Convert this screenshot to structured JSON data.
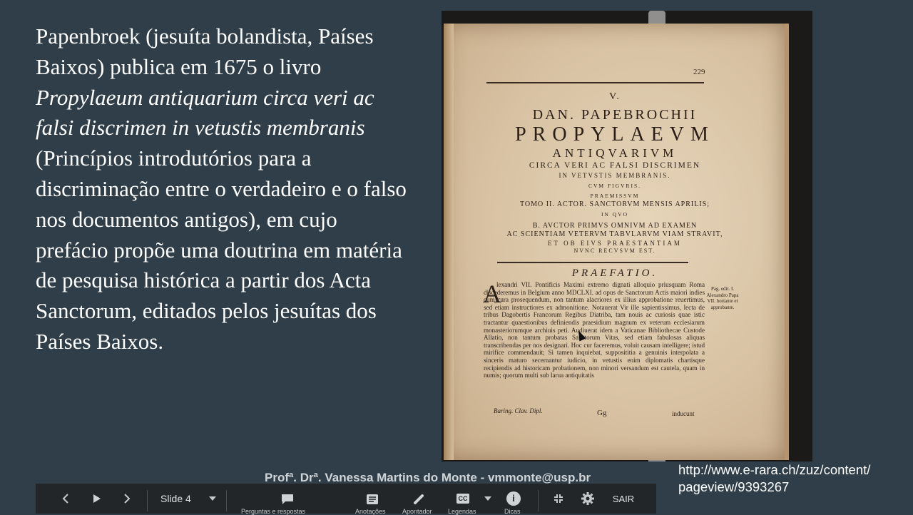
{
  "slide": {
    "text_before": "Papenbroek (jesuíta bolandista, Países Baixos) publica em 1675 o livro ",
    "italic_title": "Propylaeum antiquarium circa veri ac falsi discrimen in vetustis membranis",
    "text_after": " (Princípios introdutórios para a discriminação entre o verdadeiro e o falso nos documentos antigos), em cujo prefácio propõe uma doutrina em matéria de pesquisa histórica a partir dos Acta Sanctorum, editados pelos jesuítas dos Países Baixos."
  },
  "book_page": {
    "page_number": "229",
    "line_v": "V.",
    "line_dan": "DAN. PAPEBROCHII",
    "line_propylaeum": "PROPYLAEVM",
    "line_antiquarium": "ANTIQVARIVM",
    "line_circa": "CIRCA VERI AC FALSI DISCRIMEN",
    "line_in": "IN VETVSTIS MEMBRANIS.",
    "line_cum": "CVM FIGVRIS.",
    "line_praemissum": "PRAEMISSVM",
    "line_tomo": "TOMO II. ACTOR. SANCTORVM MENSIS APRILIS;",
    "line_inquo": "IN QVO",
    "line_bauc": "B. AVCTOR PRIMVS OMNIVM AD EXAMEN",
    "line_ac": "AC SCIENTIAM VETERVM TABVLARVM VIAM STRAVIT,",
    "line_et": "ET OB EIVS PRAESTANTIAM",
    "line_nunc": "NVNC RECVSVM EST.",
    "praefatio": "PRAEFATIO.",
    "dropcap": "A",
    "body": "lexandri VII. Pontificis Maximi extremo dignati alloquio priusquam Roma discederemus in Belgium anno MDCLXI. ad opus de Sanctorum Actis maiori indies cum cura prosequendum, non tantum alacriores ex illius approbatione reuertimus, sed etiam instructiores ex admonitione. Notauerat Vir ille sapientissimus, lecta de tribus Dagobertis Francorum Regibus Diatriba, tam nouis ac curiosis quae istic tractantur quaestionibus definiendis praesidium magnum ex veterum ecclesiarum monasteriorumque archiuis peti. Audiuerat idem a Vaticanae Bibliothecae Custode Allatio, non tantum probatas Sanctorum Vitas, sed etiam fabulosas aliquas transcribendas per nos designari. Hoc cur faceremus, voluit causam intelligere; istud mirifice commendauit; Si tamen inquiebat, supposititia a genuinis interpolata a sinceris maturo secernantur iudicio, in vetustis enim diplomatis chartisque recipiendis ad historicam probationem, non minori versandum est cautela, quam in numis; quorum multi sub larua antiquitatis",
    "margin_note": "Pag. edit. I. Alexandro Papa VII. hortante et approbante.",
    "foot_left": "Baring. Clav. Dipl.",
    "foot_mid": "Gg",
    "foot_right": "inducunt"
  },
  "footer": {
    "author": "Profª. Drª. Vanessa Martins do Monte  - vmmonte@usp.br",
    "url_line1": "http://www.e-rara.ch/zuz/content/",
    "url_line2": "pageview/9393267"
  },
  "toolbar": {
    "slide_label": "Slide 4",
    "qa_label": "Perguntas e respostas",
    "notes_label": "Anotações",
    "pointer_label": "Apontador",
    "captions_label": "Legendas",
    "tips_label": "Dicas",
    "exit_label": "SAIR",
    "captions_icon_text": "CC",
    "tips_icon_text": "i"
  },
  "colors": {
    "background": "#2f3e48",
    "toolbar": "#222628",
    "text": "#ffffff"
  }
}
